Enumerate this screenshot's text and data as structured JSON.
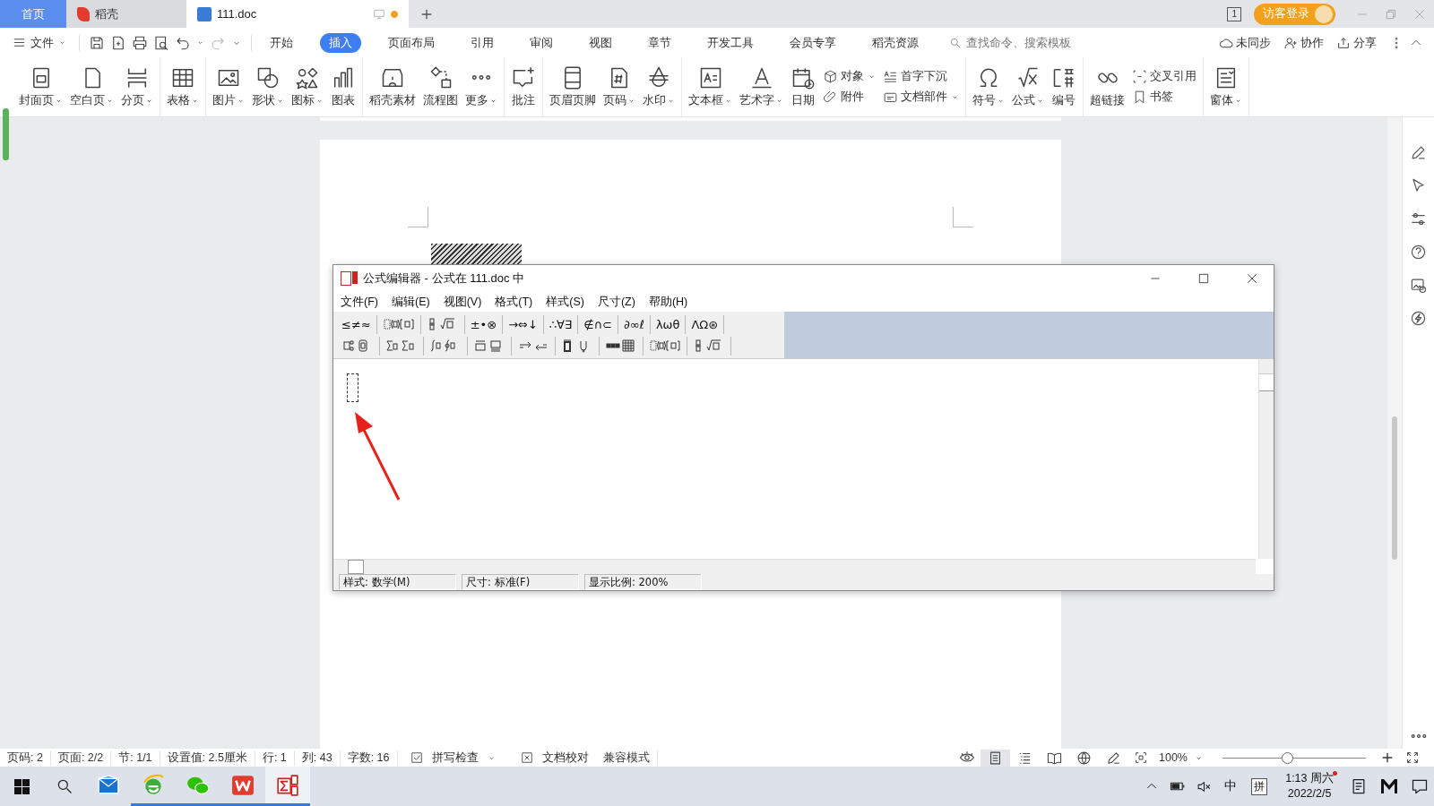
{
  "app_tabs": [
    {
      "kind": "home",
      "label": "首页",
      "selected": false
    },
    {
      "kind": "daoke",
      "label": "稻壳",
      "selected": false
    },
    {
      "kind": "document",
      "label": "111.doc",
      "selected": true,
      "modified": true
    }
  ],
  "window_count": "1",
  "login_button": "访客登录",
  "file_menu": "文件",
  "ribbon_tabs": [
    {
      "label": "开始",
      "selected": false
    },
    {
      "label": "插入",
      "selected": true
    },
    {
      "label": "页面布局",
      "selected": false
    },
    {
      "label": "引用",
      "selected": false
    },
    {
      "label": "审阅",
      "selected": false
    },
    {
      "label": "视图",
      "selected": false
    },
    {
      "label": "章节",
      "selected": false
    },
    {
      "label": "开发工具",
      "selected": false
    },
    {
      "label": "会员专享",
      "selected": false
    },
    {
      "label": "稻壳资源",
      "selected": false
    }
  ],
  "search": {
    "placeholder": "查找命令、搜索模板"
  },
  "actions": [
    "未同步",
    "协作",
    "分享"
  ],
  "ribbon_groups": [
    [
      {
        "kind": "large",
        "label": "封面页",
        "dropdown": true
      },
      {
        "kind": "large",
        "label": "空白页",
        "dropdown": true
      },
      {
        "kind": "large",
        "label": "分页",
        "dropdown": true
      }
    ],
    [
      {
        "kind": "large",
        "label": "表格",
        "dropdown": true
      }
    ],
    [
      {
        "kind": "large",
        "label": "图片",
        "dropdown": true
      },
      {
        "kind": "large",
        "label": "形状",
        "dropdown": true
      },
      {
        "kind": "large",
        "label": "图标",
        "dropdown": true
      },
      {
        "kind": "large",
        "label": "图表",
        "dropdown": false
      }
    ],
    [
      {
        "kind": "large",
        "label": "稻壳素材",
        "dropdown": false
      },
      {
        "kind": "large",
        "label": "流程图",
        "dropdown": false
      },
      {
        "kind": "large",
        "label": "更多",
        "dropdown": true
      }
    ],
    [
      {
        "kind": "large",
        "label": "批注",
        "dropdown": false
      }
    ],
    [
      {
        "kind": "large",
        "label": "页眉页脚",
        "dropdown": false
      },
      {
        "kind": "large",
        "label": "页码",
        "dropdown": true
      },
      {
        "kind": "large",
        "label": "水印",
        "dropdown": true
      }
    ],
    [
      {
        "kind": "large",
        "label": "文本框",
        "dropdown": true
      },
      {
        "kind": "large",
        "label": "艺术字",
        "dropdown": true
      },
      {
        "kind": "large",
        "label": "日期",
        "dropdown": false
      },
      {
        "kind": "stack",
        "items": [
          {
            "label": "对象",
            "dropdown": true
          },
          {
            "label": "附件",
            "dropdown": false
          }
        ]
      },
      {
        "kind": "stack",
        "items": [
          {
            "label": "首字下沉",
            "dropdown": false
          },
          {
            "label": "文档部件",
            "dropdown": true
          }
        ]
      }
    ],
    [
      {
        "kind": "large",
        "label": "符号",
        "dropdown": true
      },
      {
        "kind": "large",
        "label": "公式",
        "dropdown": true
      },
      {
        "kind": "large",
        "label": "编号",
        "dropdown": false
      }
    ],
    [
      {
        "kind": "large",
        "label": "超链接",
        "dropdown": false
      },
      {
        "kind": "stack",
        "items": [
          {
            "label": "交叉引用",
            "dropdown": false
          },
          {
            "label": "书签",
            "dropdown": false
          }
        ]
      }
    ],
    [
      {
        "kind": "large",
        "label": "窗体",
        "dropdown": true
      }
    ]
  ],
  "equation_editor": {
    "title": "公式编辑器 - 公式在 111.doc 中",
    "menu": [
      "文件(F)",
      "编辑(E)",
      "视图(V)",
      "格式(T)",
      "样式(S)",
      "尺寸(Z)",
      "帮助(H)"
    ],
    "palette": [
      [
        {
          "kind": "symbols",
          "label": "≤≠≈"
        },
        {
          "kind": "template"
        },
        {
          "kind": "template"
        },
        {
          "kind": "symbols",
          "label": "±•⊗"
        },
        {
          "kind": "symbols",
          "label": "→⇔↓"
        },
        {
          "kind": "symbols",
          "label": "∴∀∃"
        },
        {
          "kind": "symbols",
          "label": "∉∩⊂"
        },
        {
          "kind": "symbols",
          "label": "∂∞ℓ"
        },
        {
          "kind": "symbols",
          "label": "λωθ"
        },
        {
          "kind": "symbols",
          "label": "ΛΩ⊛"
        }
      ],
      [
        {
          "kind": "template"
        },
        {
          "kind": "template"
        },
        {
          "kind": "template"
        },
        {
          "kind": "template"
        },
        {
          "kind": "template"
        },
        {
          "kind": "template"
        },
        {
          "kind": "template"
        },
        {
          "kind": "template"
        },
        {
          "kind": "template"
        }
      ]
    ],
    "status": [
      "样式: 数学(M)",
      "尺寸: 标准(F)",
      "显示比例: 200%"
    ]
  },
  "status_bar": {
    "items": [
      "页码: 2",
      "页面: 2/2",
      "节: 1/1",
      "设置值: 2.5厘米",
      "行: 1",
      "列: 43",
      "字数: 16"
    ],
    "spell_check": "拼写检查",
    "proofread": "文档校对",
    "compat": "兼容模式",
    "view_modes": [
      {
        "selected": true
      },
      {
        "selected": false
      },
      {
        "selected": false
      },
      {
        "selected": false
      },
      {
        "selected": false
      }
    ],
    "zoom": "100%",
    "zoom_slider": {
      "level": 0.45
    }
  },
  "taskbar": {
    "apps": [
      {
        "running": false,
        "selected": false
      },
      {
        "running": true,
        "selected": false
      },
      {
        "running": true,
        "selected": false
      },
      {
        "running": true,
        "selected": false
      },
      {
        "running": true,
        "selected": true
      }
    ],
    "ime_mode": "中",
    "ime": "拼",
    "time": "1:13 周六",
    "date": "2022/2/5"
  }
}
